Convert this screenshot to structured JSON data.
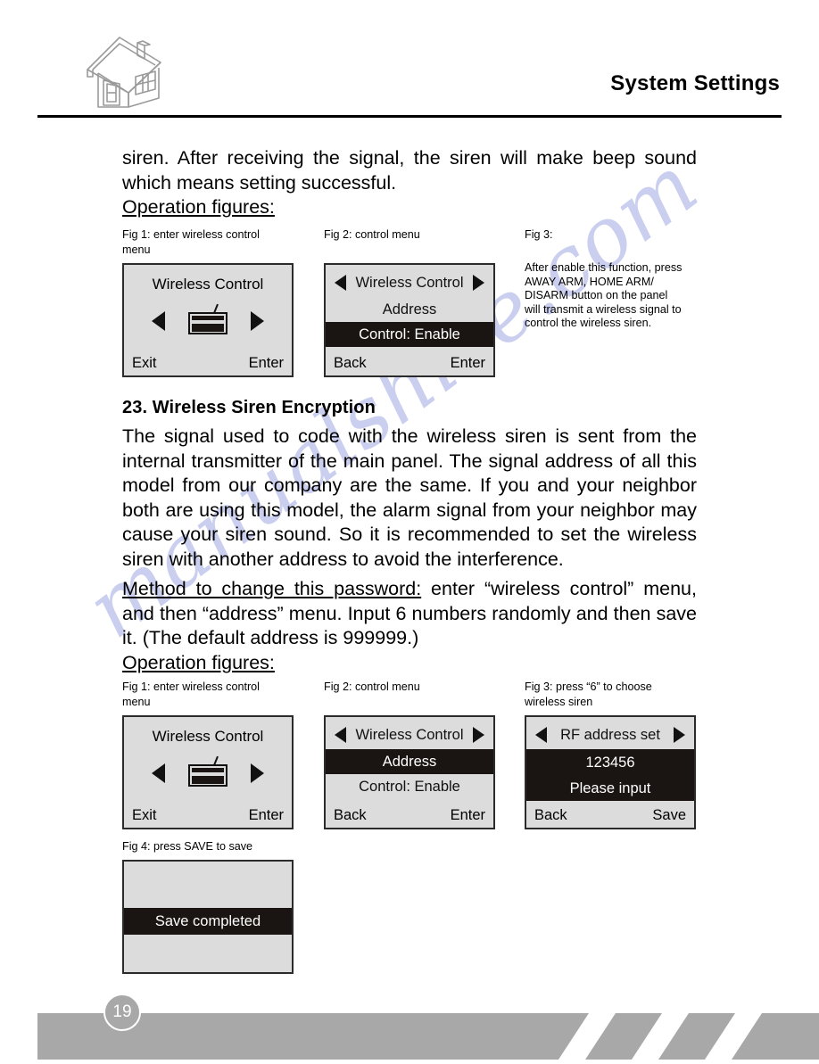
{
  "header": {
    "title": "System Settings",
    "logo_icon": "house-icon"
  },
  "body": {
    "intro_paragraph": "siren. After receiving the signal, the siren will make beep sound which means setting successful.",
    "operation_figures_label_1": "Operation figures:",
    "section_heading": "23. Wireless Siren Encryption",
    "section_paragraph": "The signal used to code with the wireless siren is sent from the internal transmitter of the main panel. The signal address of all this model from our company are the same. If you and your neighbor both are using this model, the alarm signal from your neighbor may cause your siren sound. So it is recommended to set the wireless siren with another address to avoid the interference.",
    "method_underlined": "Method to change this password:",
    "method_rest": " enter “wireless control” menu, and then “address” menu. Input 6 numbers randomly and then save it. (The default address is 999999.)",
    "operation_figures_label_2": "Operation figures:"
  },
  "figures_row1": {
    "fig1": {
      "caption": "Fig 1: enter wireless control\n          menu",
      "lcd": {
        "title": "Wireless Control",
        "icon": "siren-icon",
        "left_arrow": "left-arrow-icon",
        "right_arrow": "right-arrow-icon",
        "footer_left": "Exit",
        "footer_right": "Enter"
      }
    },
    "fig2": {
      "caption": "Fig 2: control menu",
      "lcd": {
        "title": "Wireless Control",
        "row_address": "Address",
        "row_control": "Control: Enable",
        "highlighted_row": "Control: Enable",
        "footer_left": "Back",
        "footer_right": "Enter"
      }
    },
    "fig3": {
      "caption": "Fig 3:",
      "note": "After enable this function, press\nAWAY ARM, HOME ARM/\nDISARM button on the panel\nwill transmit a wireless signal to\ncontrol the wireless siren."
    }
  },
  "figures_row2": {
    "fig1": {
      "caption": "Fig 1: enter wireless control\n          menu",
      "lcd": {
        "title": "Wireless Control",
        "icon": "siren-icon",
        "footer_left": "Exit",
        "footer_right": "Enter"
      }
    },
    "fig2": {
      "caption": "Fig 2: control menu",
      "lcd": {
        "title": "Wireless Control",
        "row_address": "Address",
        "row_control": "Control: Enable",
        "highlighted_row": "Address",
        "footer_left": "Back",
        "footer_right": "Enter"
      }
    },
    "fig3": {
      "caption": "Fig 3: press “6” to choose\n             wireless siren",
      "lcd": {
        "title": "RF address set",
        "row_value": "123456",
        "row_prompt": "Please  input",
        "footer_left": "Back",
        "footer_right": "Save"
      }
    },
    "fig4": {
      "caption": "Fig 4: press SAVE to save",
      "lcd": {
        "message": "Save  completed"
      }
    }
  },
  "footer": {
    "page_number": "19"
  },
  "watermark": {
    "text": "manualshive.com"
  },
  "colors": {
    "lcd_background": "#dcdcdc",
    "lcd_border": "#2b2b2b",
    "lcd_inverted": "#1a1512",
    "footer_bar": "#a8a8a8",
    "watermark": "#c7cbee"
  }
}
